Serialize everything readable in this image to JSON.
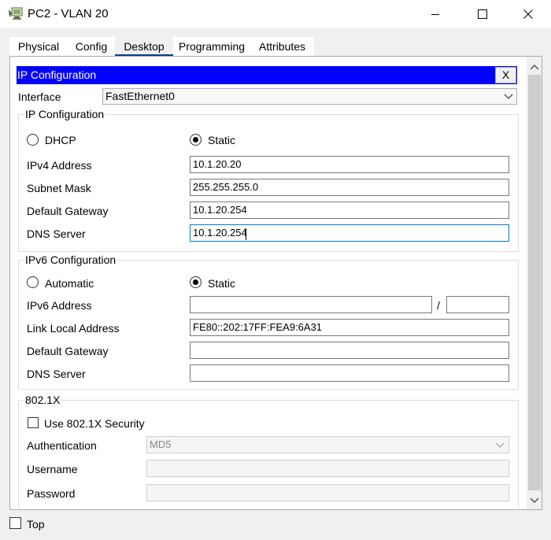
{
  "window": {
    "title": "PC2 - VLAN 20",
    "icon": "pc-icon",
    "controls": [
      "minimize-icon",
      "maximize-icon",
      "close-icon"
    ]
  },
  "tabs": [
    {
      "label": "Physical",
      "active": false
    },
    {
      "label": "Config",
      "active": false
    },
    {
      "label": "Desktop",
      "active": true
    },
    {
      "label": "Programming",
      "active": false
    },
    {
      "label": "Attributes",
      "active": false
    }
  ],
  "ip_config": {
    "header": "IP Configuration",
    "close_label": "X",
    "interface_label": "Interface",
    "interface_value": "FastEthernet0",
    "ipv4": {
      "group_title": "IP Configuration",
      "dhcp_label": "DHCP",
      "static_label": "Static",
      "selected": "Static",
      "address_label": "IPv4 Address",
      "address_value": "10.1.20.20",
      "mask_label": "Subnet Mask",
      "mask_value": "255.255.255.0",
      "gateway_label": "Default Gateway",
      "gateway_value": "10.1.20.254",
      "dns_label": "DNS Server",
      "dns_value": "10.1.20.254"
    },
    "ipv6": {
      "group_title": "IPv6 Configuration",
      "auto_label": "Automatic",
      "static_label": "Static",
      "selected": "Static",
      "address_label": "IPv6 Address",
      "address_value": "",
      "slash": "/",
      "prefix_value": "",
      "link_local_label": "Link Local Address",
      "link_local_value": "FE80::202:17FF:FEA9:6A31",
      "gateway_label": "Default Gateway",
      "gateway_value": "",
      "dns_label": "DNS Server",
      "dns_value": ""
    },
    "dot1x": {
      "group_title": "802.1X",
      "use_label": "Use 802.1X Security",
      "use_checked": false,
      "auth_label": "Authentication",
      "auth_value": "MD5",
      "username_label": "Username",
      "username_value": "",
      "password_label": "Password",
      "password_value": ""
    }
  },
  "footer": {
    "top_label": "Top",
    "top_checked": false
  }
}
